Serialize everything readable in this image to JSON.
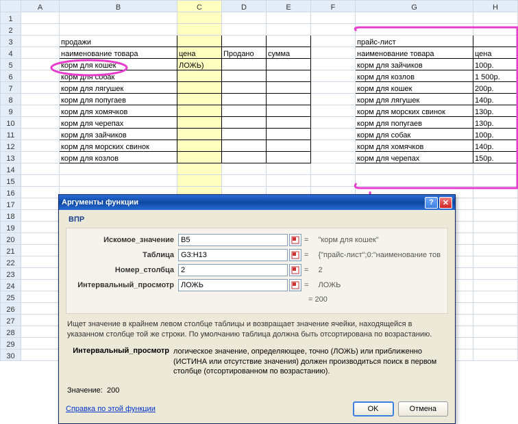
{
  "columns": [
    "A",
    "B",
    "C",
    "D",
    "E",
    "F",
    "G",
    "H"
  ],
  "rows": [
    1,
    2,
    3,
    4,
    5,
    6,
    7,
    8,
    9,
    10,
    11,
    12,
    13,
    14,
    15,
    16,
    17,
    18,
    19,
    20,
    21,
    22,
    23,
    24,
    25,
    26,
    27,
    28,
    29,
    30
  ],
  "sales": {
    "title": "продажи",
    "headers": {
      "name": "наименование товара",
      "price": "цена",
      "sold": "Продано",
      "sum": "сумма"
    },
    "rows": [
      {
        "name": "корм для кошек",
        "price": "ЛОЖЬ)"
      },
      {
        "name": "корм для собак"
      },
      {
        "name": "корм для лягушек"
      },
      {
        "name": "корм для попугаев"
      },
      {
        "name": "корм для хомячков"
      },
      {
        "name": "корм для черепах"
      },
      {
        "name": "корм для зайчиков"
      },
      {
        "name": "корм для морских свинок"
      },
      {
        "name": "корм для козлов"
      }
    ]
  },
  "pricelist": {
    "title": "прайс-лист",
    "headers": {
      "name": "наименование товара",
      "price": "цена"
    },
    "rows": [
      {
        "name": "корм для зайчиков",
        "price": "100р."
      },
      {
        "name": "корм для козлов",
        "price": "1 500р."
      },
      {
        "name": "корм для кошек",
        "price": "200р."
      },
      {
        "name": "корм для лягушек",
        "price": "140р."
      },
      {
        "name": "корм для морских свинок",
        "price": "130р."
      },
      {
        "name": "корм для попугаев",
        "price": "130р."
      },
      {
        "name": "корм для собак",
        "price": "100р."
      },
      {
        "name": "корм для хомячков",
        "price": "140р."
      },
      {
        "name": "корм для черепах",
        "price": "150р."
      }
    ]
  },
  "dialog": {
    "title": "Аргументы функции",
    "func": "ВПР",
    "args": {
      "lookup": {
        "label": "Искомое_значение",
        "value": "B5",
        "result": "\"корм для кошек\""
      },
      "table": {
        "label": "Таблица",
        "value": "G3:H13",
        "result": "{\"прайс-лист\";0:\"наименование тов"
      },
      "col": {
        "label": "Номер_столбца",
        "value": "2",
        "result": "2"
      },
      "interval": {
        "label": "Интервальный_просмотр",
        "value": "ЛОЖЬ",
        "result": "ЛОЖЬ"
      }
    },
    "overall_result": "= 200",
    "desc": "Ищет значение в крайнем левом столбце таблицы и возвращает значение ячейки, находящейся в указанном столбце той же строки. По умолчанию таблица должна быть отсортирована по возрастанию.",
    "arg_desc_label": "Интервальный_просмотр",
    "arg_desc_text": "логическое значение, определяющее, точно (ЛОЖЬ) или приближенно (ИСТИНА или отсутствие значения) должен производиться поиск в первом столбце (отсортированном по возрастанию).",
    "value_label": "Значение:",
    "value": "200",
    "help_link": "Справка по этой функции",
    "ok": "OK",
    "cancel": "Отмена"
  }
}
